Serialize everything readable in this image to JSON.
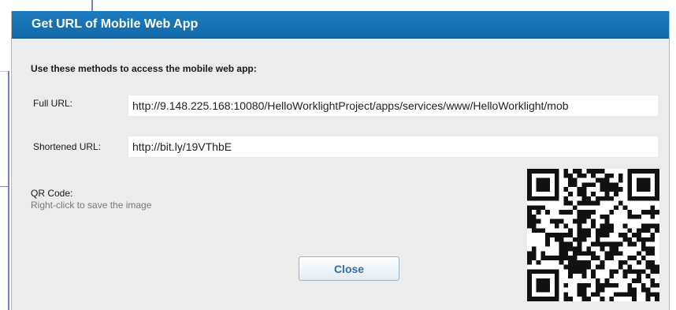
{
  "dialog": {
    "title": "Get URL of Mobile Web App",
    "intro": "Use these methods to access the mobile web app:",
    "full_url": {
      "label": "Full URL:",
      "value": "http://9.148.225.168:10080/HelloWorklightProject/apps/services/www/HelloWorklight/mob"
    },
    "short_url": {
      "label": "Shortened URL:",
      "value": "http://bit.ly/19VThbE"
    },
    "qr": {
      "label": "QR Code:",
      "hint": "Right-click to save the image"
    },
    "close_label": "Close"
  },
  "colors": {
    "titlebar": "#1774b6",
    "dialog_bg": "#ececec",
    "button_text": "#2d6fab"
  }
}
